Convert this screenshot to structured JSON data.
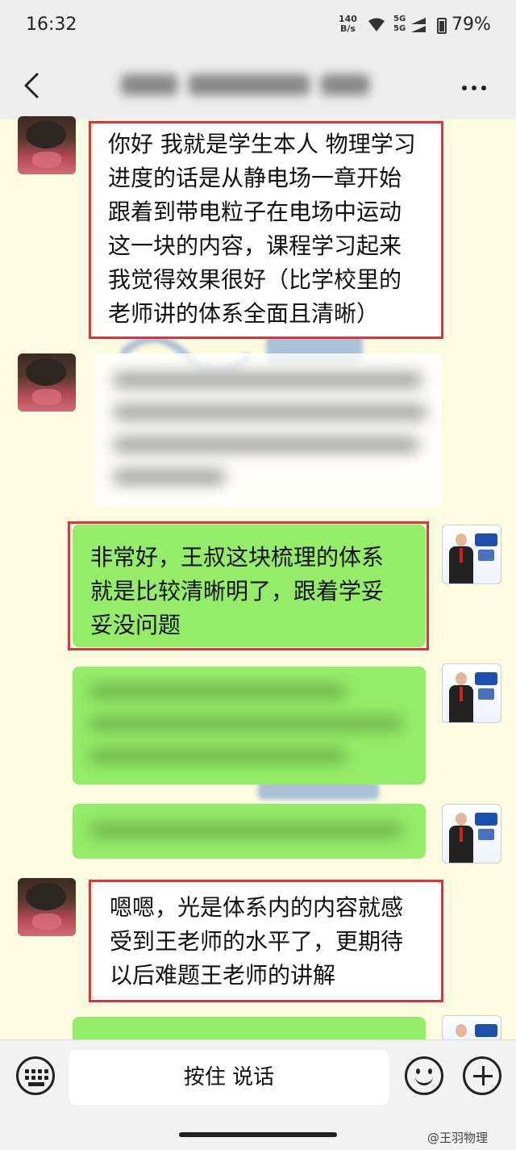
{
  "status": {
    "time": "16:32",
    "net_speed": "140",
    "net_unit": "B/s",
    "signal1": "5G",
    "signal2": "5G",
    "battery": "79%"
  },
  "header": {
    "back_icon": "chevron-left-icon",
    "more_icon": "more-dots-icon"
  },
  "messages": [
    {
      "sender": "student",
      "text": "你好 我就是学生本人 物理学习\n进度的话是从静电场一章开始\n跟着到带电粒子在电场中运动\n这一块的内容，课程学习起来\n我觉得效果很好（比学校里的\n老师讲的体系全面且清晰）"
    },
    {
      "sender": "teacher",
      "text": "非常好，王叔这块梳理的体系\n就是比较清晰明了，跟着学妥\n妥没问题"
    },
    {
      "sender": "student",
      "text": "嗯嗯，光是体系内的内容就感\n受到王老师的水平了，更期待\n以后难题王老师的讲解"
    }
  ],
  "input": {
    "voice_label": "按住 说话"
  },
  "watermark": "@王羽物理",
  "colors": {
    "chat_bg": "#fdfbe0",
    "bubble_green": "#95ec69",
    "highlight_red": "#e0323a"
  }
}
